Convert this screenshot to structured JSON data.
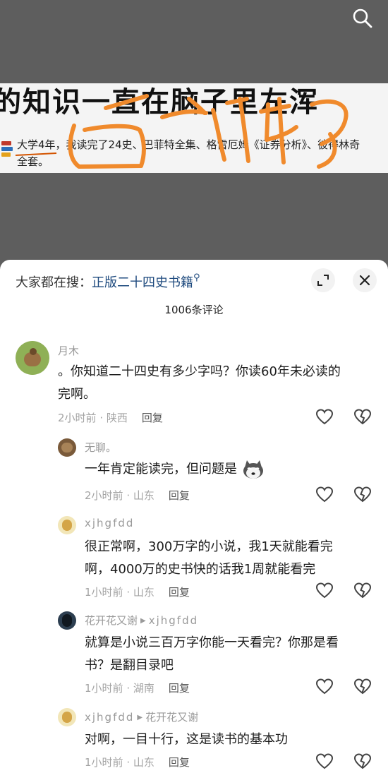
{
  "video": {
    "headline": "的知识一直在脑子里左浑",
    "line1_parts": [
      "大学4年，",
      "我读完了24史、巴菲特全集、格雷厄姆《证券分析》、彼得林奇"
    ],
    "line2": "全套。"
  },
  "sheet": {
    "search_prefix": "大家都在搜：",
    "search_link": "正版二十四史书籍",
    "comment_count": "1006条评论"
  },
  "comments": [
    {
      "author": "月木",
      "text_line1": "。你知道二十四史有多少字吗？你读60年未必读的",
      "text_line2": "完啊。",
      "time": "2小时前",
      "loc": "陕西",
      "reply": "回复"
    },
    {
      "author": "无聊。",
      "text_line1": "一年肯定能读完，但问题是",
      "time": "2小时前",
      "loc": "山东",
      "reply": "回复"
    },
    {
      "author": "xjhgfdd",
      "text_line1": "很正常啊，300万字的小说，我1天就能看完",
      "text_line2": "啊，4000万的史书快的话我1周就能看完",
      "time": "1小时前",
      "loc": "山东",
      "reply": "回复"
    },
    {
      "author": "花开花又谢",
      "reply_to": "xjhgfdd",
      "text_line1": "就算是小说三百万字你能一天看完？你那是看",
      "text_line2": "书？是翻目录吧",
      "time": "1小时前",
      "loc": "湖南",
      "reply": "回复"
    },
    {
      "author": "xjhgfdd",
      "reply_to": "花开花又谢",
      "text_line1": "对啊，一目十行，这是读书的基本功",
      "time": "1小时前",
      "loc": "山东",
      "reply": "回复"
    }
  ],
  "meta_separator": "·"
}
